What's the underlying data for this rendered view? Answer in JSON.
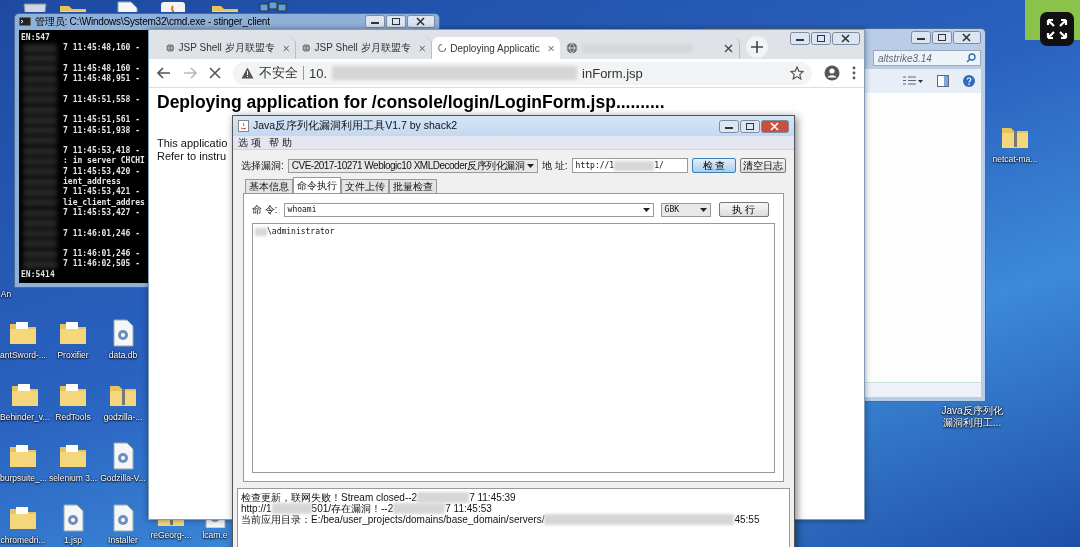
{
  "desktop_icons": [
    {
      "label": "antSword-...",
      "kind": "folder"
    },
    {
      "label": "Proxifier",
      "kind": "folder"
    },
    {
      "label": "data.db",
      "kind": "file"
    },
    {
      "label": "Behinder_v...",
      "kind": "folder"
    },
    {
      "label": "RedTools",
      "kind": "folder"
    },
    {
      "label": "godzilla-...",
      "kind": "zip"
    },
    {
      "label": "burpsuite_...",
      "kind": "folder"
    },
    {
      "label": "selenium 3...",
      "kind": "folder"
    },
    {
      "label": "Godzilla-V...",
      "kind": "file"
    },
    {
      "label": "chromedri...",
      "kind": "folder"
    },
    {
      "label": "1.jsp",
      "kind": "file"
    },
    {
      "label": "Installer",
      "kind": "file"
    },
    {
      "label": "reGeorg-...",
      "kind": "zip"
    },
    {
      "label": "lcam.e",
      "kind": "file"
    },
    {
      "label": "An",
      "kind": "label"
    },
    {
      "label": "netcat-ma...",
      "kind": "zip"
    },
    {
      "label": "Java反序列化漏洞利用工...",
      "kind": "label"
    }
  ],
  "cmd_window": {
    "title": "管理员: C:\\Windows\\System32\\cmd.exe - stinger_client",
    "lines": [
      {
        "text": "EN:547",
        "redacted": false,
        "gap_before": false
      },
      {
        "text": "7 11:45:48,160 -",
        "redacted": true,
        "gap_before": false
      },
      {
        "text": "7 11:45:48,160 -",
        "redacted": true,
        "gap_before": true
      },
      {
        "text": "7 11:45:48,951 -",
        "redacted": true,
        "gap_before": false
      },
      {
        "text": "7 11:45:51,558 -",
        "redacted": true,
        "gap_before": true
      },
      {
        "text": "7 11:45:51,561 -",
        "redacted": true,
        "gap_before": true
      },
      {
        "text": "7 11:45:51,938 -",
        "redacted": true,
        "gap_before": false
      },
      {
        "text": "7 11:45:53,418 -",
        "redacted": true,
        "gap_before": true
      },
      {
        "text": ": in server CHCHI",
        "redacted": true,
        "gap_before": false
      },
      {
        "text": "7 11:45:53,420 -",
        "redacted": true,
        "gap_before": false
      },
      {
        "text": "ient_address",
        "redacted": true,
        "gap_before": false
      },
      {
        "text": "7 11:45:53,421 -",
        "redacted": true,
        "gap_before": false
      },
      {
        "text": "lie_client_addres",
        "redacted": true,
        "gap_before": false
      },
      {
        "text": "7 11:45:53,427 -",
        "redacted": true,
        "gap_before": false
      },
      {
        "text": "7 11:46:01,246 -",
        "redacted": true,
        "gap_before": true
      },
      {
        "text": "7 11:46:01,246 -",
        "redacted": true,
        "gap_before": true
      },
      {
        "text": "7 11:46:02,505 -",
        "redacted": true,
        "gap_before": false
      },
      {
        "text": "EN:5414",
        "redacted": false,
        "gap_before": false
      }
    ]
  },
  "browser": {
    "tabs": [
      {
        "label": "JSP Shell 岁月联盟专",
        "selected": false,
        "loading": false
      },
      {
        "label": "JSP Shell 岁月联盟专",
        "selected": false,
        "loading": false
      },
      {
        "label": "Deploying Applicatic",
        "selected": true,
        "loading": true
      },
      {
        "selected": false,
        "loading": false
      }
    ],
    "address": {
      "warning": "不安全",
      "url_start": "10.",
      "url_end": "inForm.jsp"
    },
    "heading": "Deploying application for /console/login/LoginForm.jsp..........",
    "paragraph_lines": [
      "This applicatio",
      "Refer to instru"
    ]
  },
  "explorer": {
    "path": "altstrike3.14"
  },
  "java_tool": {
    "title": "Java反序列化漏洞利用工具V1.7 by shack2",
    "menu": [
      "选 项",
      "帮 助"
    ],
    "vuln_label": "选择漏洞:",
    "vuln_value": "CVE-2017-10271 Weblogic10 XMLDecoder反序列化漏洞",
    "address_label": "地 址:",
    "address_start": "http://1",
    "address_end": "1/",
    "check_button": "检 查",
    "clear_button": "清空日志",
    "tabs": [
      {
        "label": "基本信息",
        "selected": false
      },
      {
        "label": "命令执行",
        "selected": true
      },
      {
        "label": "文件上传",
        "selected": false
      },
      {
        "label": "批量检查",
        "selected": false
      }
    ],
    "command_label": "命 令:",
    "command_value": "whoami",
    "encoding": "GBK",
    "run_button": "执 行",
    "output": "\\administrator",
    "log": [
      {
        "before": "检查更新，联网失败！Stream closed--2",
        "after": "7 11:45:39"
      },
      {
        "before": "http://1",
        "middle": "501/存在漏洞！--2",
        "after": "7 11:45:53"
      },
      {
        "before": "当前应用目录：E:/bea/user_projects/domains/base_domain/servers/",
        "after": "45:55"
      }
    ]
  }
}
